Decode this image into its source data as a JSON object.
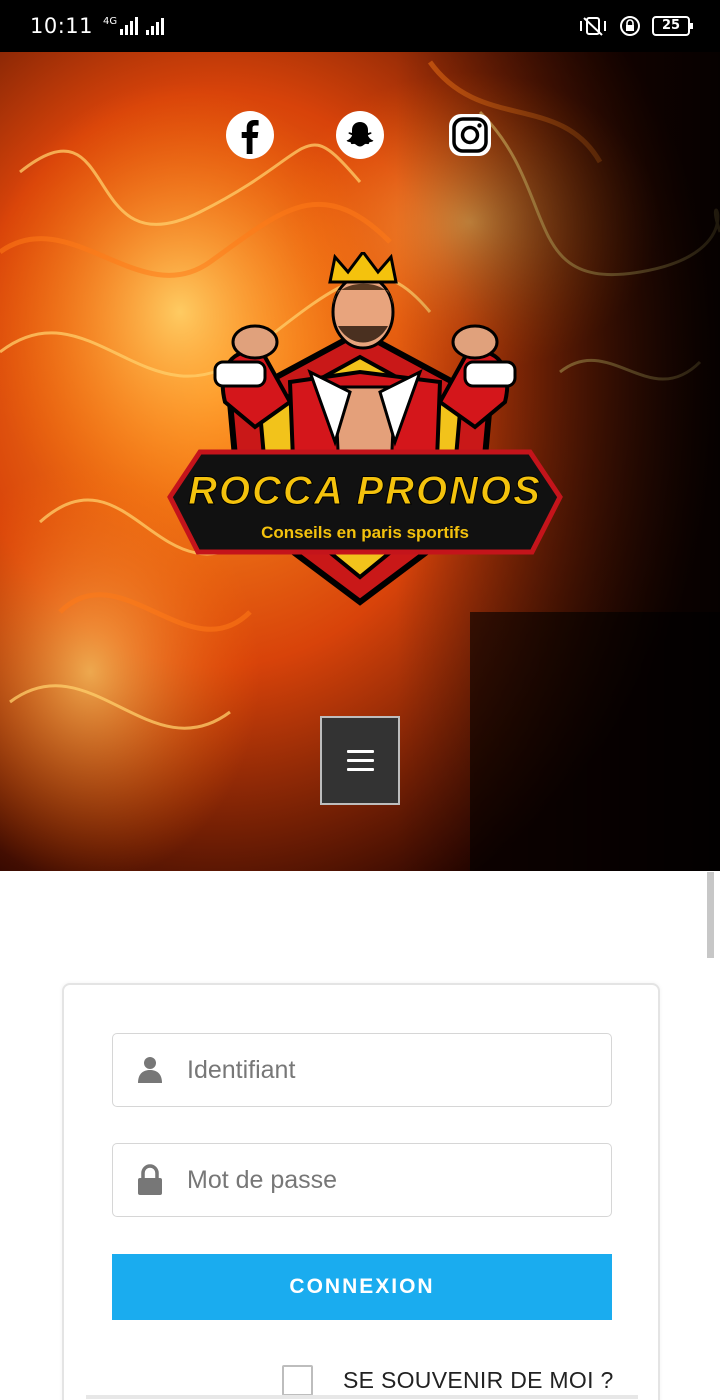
{
  "status_bar": {
    "time": "10:11",
    "network": "4G",
    "battery": "25"
  },
  "hero": {
    "social_icons": [
      "facebook-icon",
      "snapchat-icon",
      "instagram-icon"
    ],
    "logo": {
      "title": "ROCCA PRONOS",
      "subtitle": "Conseils en paris sportifs"
    },
    "menu_icon": "hamburger-icon"
  },
  "login": {
    "username_placeholder": "Identifiant",
    "password_placeholder": "Mot de passe",
    "submit_label": "CONNEXION",
    "remember_label": "SE SOUVENIR DE MOI ?"
  },
  "colors": {
    "accent": "#1aacef",
    "hero_bg": "#000000",
    "menu_button": "#333333"
  }
}
